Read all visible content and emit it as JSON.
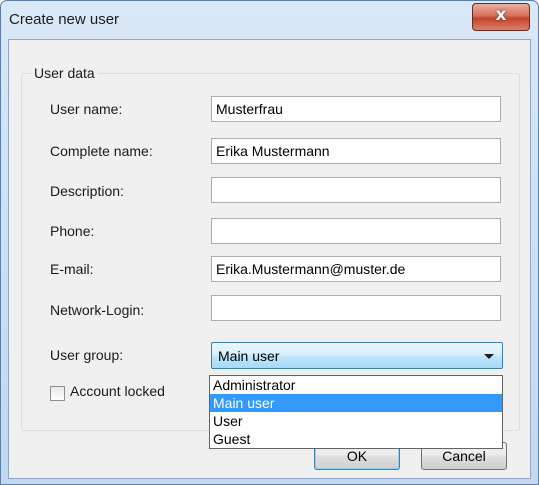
{
  "window": {
    "title": "Create new user",
    "close_glyph": "x"
  },
  "group": {
    "title": "User data"
  },
  "fields": [
    {
      "label": "User name:",
      "value": "Musterfrau"
    },
    {
      "label": "Complete name:",
      "value": "Erika Mustermann"
    },
    {
      "label": "Description:",
      "value": ""
    },
    {
      "label": "Phone:",
      "value": ""
    },
    {
      "label": "E-mail:",
      "value": "Erika.Mustermann@muster.de"
    },
    {
      "label": "Network-Login:",
      "value": ""
    }
  ],
  "user_group": {
    "label": "User group:",
    "selected": "Main user",
    "options": [
      "Administrator",
      "Main user",
      "User",
      "Guest"
    ]
  },
  "account_locked": {
    "label": "Account locked",
    "checked": false
  },
  "buttons": {
    "ok": "OK",
    "cancel": "Cancel"
  },
  "colors": {
    "accent": "#3399ff",
    "close": "#c3432b"
  }
}
